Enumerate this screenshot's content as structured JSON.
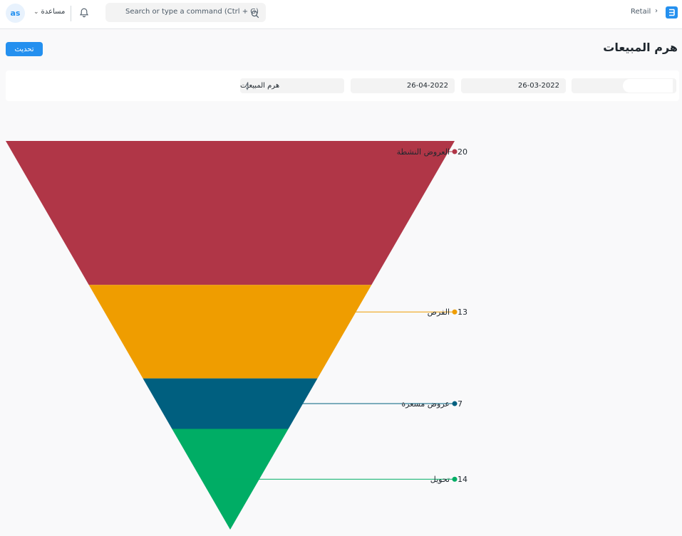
{
  "navbar": {
    "avatar_initials": "as",
    "help_label": "مساعدة",
    "search_placeholder": "Search or type a command (Ctrl + G)",
    "breadcrumb": "Retail",
    "brand_color": "#2490ef"
  },
  "page": {
    "title": "هرم المبيعات",
    "update_button": "تحديث"
  },
  "filters": {
    "company": "",
    "from_date": "26-03-2022",
    "to_date": "26-04-2022",
    "view_by": "هرم المبيعات"
  },
  "chart_data": {
    "type": "funnel",
    "stages": [
      {
        "label": "العروض النشطة",
        "value": 20,
        "color": "#b03647"
      },
      {
        "label": "الفرص",
        "value": 13,
        "color": "#ef9d00"
      },
      {
        "label": "عروض مسعرة",
        "value": 7,
        "color": "#005f7f"
      },
      {
        "label": "تحويل",
        "value": 14,
        "color": "#00ad65"
      }
    ]
  }
}
